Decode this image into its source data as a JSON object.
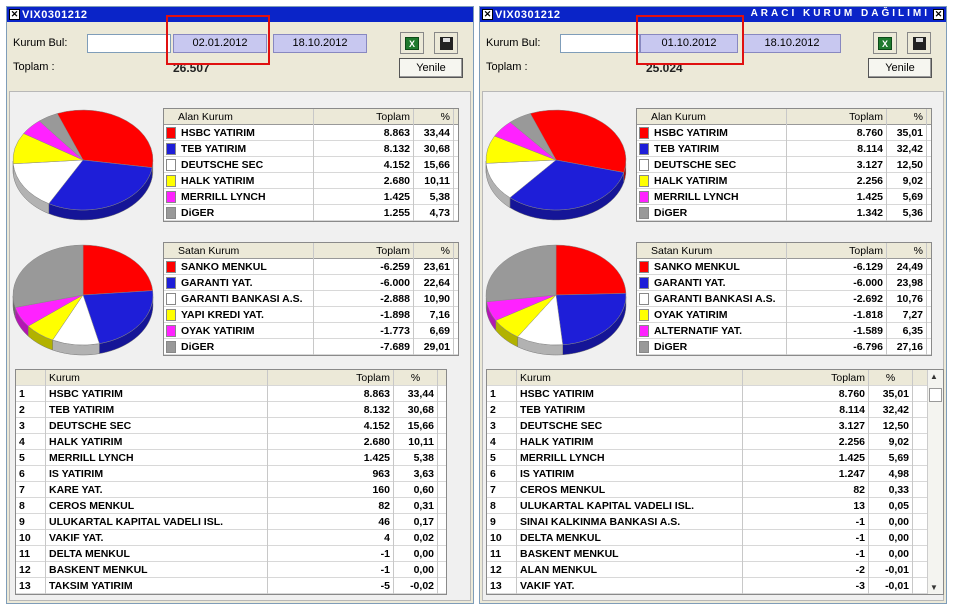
{
  "colors": {
    "red": "#ff0000",
    "blue": "#1e1ed8",
    "white": "#ffffff",
    "yellow": "#ffff00",
    "magenta": "#ff22ff",
    "gray": "#999999"
  },
  "panels": [
    {
      "title": "VIX0301212",
      "subtitle": "",
      "kurum_label": "Kurum Bul:",
      "date_from": "02.01.2012",
      "date_to": "18.10.2012",
      "toplam_label": "Toplam :",
      "toplam_value": "26.507",
      "yenile_label": "Yenile",
      "alan": {
        "headers": [
          "Alan Kurum",
          "Toplam",
          "%"
        ],
        "rows": [
          {
            "name": "HSBC YATIRIM",
            "toplam": "8.863",
            "pct": "33,44",
            "color": "#ff0000"
          },
          {
            "name": "TEB YATIRIM",
            "toplam": "8.132",
            "pct": "30,68",
            "color": "#1e1ed8"
          },
          {
            "name": "DEUTSCHE SEC",
            "toplam": "4.152",
            "pct": "15,66",
            "color": "#ffffff"
          },
          {
            "name": "HALK YATIRIM",
            "toplam": "2.680",
            "pct": "10,11",
            "color": "#ffff00"
          },
          {
            "name": "MERRILL LYNCH",
            "toplam": "1.425",
            "pct": "5,38",
            "color": "#ff22ff"
          },
          {
            "name": "DiGER",
            "toplam": "1.255",
            "pct": "4,73",
            "color": "#999999"
          }
        ],
        "pie_values": [
          33.44,
          30.68,
          15.66,
          10.11,
          5.38,
          4.73
        ]
      },
      "satan": {
        "headers": [
          "Satan Kurum",
          "Toplam",
          "%"
        ],
        "rows": [
          {
            "name": "SANKO MENKUL",
            "toplam": "-6.259",
            "pct": "23,61",
            "color": "#ff0000"
          },
          {
            "name": "GARANTI YAT.",
            "toplam": "-6.000",
            "pct": "22,64",
            "color": "#1e1ed8"
          },
          {
            "name": "GARANTI BANKASI A.S.",
            "toplam": "-2.888",
            "pct": "10,90",
            "color": "#ffffff"
          },
          {
            "name": "YAPI KREDI YAT.",
            "toplam": "-1.898",
            "pct": "7,16",
            "color": "#ffff00"
          },
          {
            "name": "OYAK YATIRIM",
            "toplam": "-1.773",
            "pct": "6,69",
            "color": "#ff22ff"
          },
          {
            "name": "DiGER",
            "toplam": "-7.689",
            "pct": "29,01",
            "color": "#999999"
          }
        ],
        "pie_values": [
          23.61,
          22.64,
          10.9,
          7.16,
          6.69,
          29.01
        ]
      },
      "list": {
        "headers": [
          "",
          "Kurum",
          "Toplam",
          "%"
        ],
        "rows": [
          [
            "1",
            "HSBC YATIRIM",
            "8.863",
            "33,44"
          ],
          [
            "2",
            "TEB YATIRIM",
            "8.132",
            "30,68"
          ],
          [
            "3",
            "DEUTSCHE SEC",
            "4.152",
            "15,66"
          ],
          [
            "4",
            "HALK YATIRIM",
            "2.680",
            "10,11"
          ],
          [
            "5",
            "MERRILL LYNCH",
            "1.425",
            "5,38"
          ],
          [
            "6",
            "IS YATIRIM",
            "963",
            "3,63"
          ],
          [
            "7",
            "KARE YAT.",
            "160",
            "0,60"
          ],
          [
            "8",
            "CEROS MENKUL",
            "82",
            "0,31"
          ],
          [
            "9",
            "ULUKARTAL KAPITAL VADELI ISL.",
            "46",
            "0,17"
          ],
          [
            "10",
            "VAKIF YAT.",
            "4",
            "0,02"
          ],
          [
            "11",
            "DELTA MENKUL",
            "-1",
            "0,00"
          ],
          [
            "12",
            "BASKENT MENKUL",
            "-1",
            "0,00"
          ],
          [
            "13",
            "TAKSIM YATIRIM",
            "-5",
            "-0,02"
          ]
        ]
      }
    },
    {
      "title": "VIX0301212",
      "subtitle": "ARACI KURUM DAĞILIMI",
      "kurum_label": "Kurum Bul:",
      "date_from": "01.10.2012",
      "date_to": "18.10.2012",
      "toplam_label": "Toplam :",
      "toplam_value": "25.024",
      "yenile_label": "Yenile",
      "alan": {
        "headers": [
          "Alan Kurum",
          "Toplam",
          "%"
        ],
        "rows": [
          {
            "name": "HSBC YATIRIM",
            "toplam": "8.760",
            "pct": "35,01",
            "color": "#ff0000"
          },
          {
            "name": "TEB YATIRIM",
            "toplam": "8.114",
            "pct": "32,42",
            "color": "#1e1ed8"
          },
          {
            "name": "DEUTSCHE SEC",
            "toplam": "3.127",
            "pct": "12,50",
            "color": "#ffffff"
          },
          {
            "name": "HALK YATIRIM",
            "toplam": "2.256",
            "pct": "9,02",
            "color": "#ffff00"
          },
          {
            "name": "MERRILL LYNCH",
            "toplam": "1.425",
            "pct": "5,69",
            "color": "#ff22ff"
          },
          {
            "name": "DiGER",
            "toplam": "1.342",
            "pct": "5,36",
            "color": "#999999"
          }
        ],
        "pie_values": [
          35.01,
          32.42,
          12.5,
          9.02,
          5.69,
          5.36
        ]
      },
      "satan": {
        "headers": [
          "Satan Kurum",
          "Toplam",
          "%"
        ],
        "rows": [
          {
            "name": "SANKO MENKUL",
            "toplam": "-6.129",
            "pct": "24,49",
            "color": "#ff0000"
          },
          {
            "name": "GARANTI YAT.",
            "toplam": "-6.000",
            "pct": "23,98",
            "color": "#1e1ed8"
          },
          {
            "name": "GARANTI BANKASI A.S.",
            "toplam": "-2.692",
            "pct": "10,76",
            "color": "#ffffff"
          },
          {
            "name": "OYAK YATIRIM",
            "toplam": "-1.818",
            "pct": "7,27",
            "color": "#ffff00"
          },
          {
            "name": "ALTERNATIF YAT.",
            "toplam": "-1.589",
            "pct": "6,35",
            "color": "#ff22ff"
          },
          {
            "name": "DiGER",
            "toplam": "-6.796",
            "pct": "27,16",
            "color": "#999999"
          }
        ],
        "pie_values": [
          24.49,
          23.98,
          10.76,
          7.27,
          6.35,
          27.16
        ]
      },
      "list": {
        "headers": [
          "",
          "Kurum",
          "Toplam",
          "%"
        ],
        "rows": [
          [
            "1",
            "HSBC YATIRIM",
            "8.760",
            "35,01"
          ],
          [
            "2",
            "TEB YATIRIM",
            "8.114",
            "32,42"
          ],
          [
            "3",
            "DEUTSCHE SEC",
            "3.127",
            "12,50"
          ],
          [
            "4",
            "HALK YATIRIM",
            "2.256",
            "9,02"
          ],
          [
            "5",
            "MERRILL LYNCH",
            "1.425",
            "5,69"
          ],
          [
            "6",
            "IS YATIRIM",
            "1.247",
            "4,98"
          ],
          [
            "7",
            "CEROS MENKUL",
            "82",
            "0,33"
          ],
          [
            "8",
            "ULUKARTAL KAPITAL VADELI ISL.",
            "13",
            "0,05"
          ],
          [
            "9",
            "SINAI KALKINMA BANKASI A.S.",
            "-1",
            "0,00"
          ],
          [
            "10",
            "DELTA MENKUL",
            "-1",
            "0,00"
          ],
          [
            "11",
            "BASKENT MENKUL",
            "-1",
            "0,00"
          ],
          [
            "12",
            "ALAN MENKUL",
            "-2",
            "-0,01"
          ],
          [
            "13",
            "VAKIF YAT.",
            "-3",
            "-0,01"
          ]
        ]
      }
    }
  ],
  "chart_data": [
    {
      "type": "pie",
      "categories": [
        "HSBC YATIRIM",
        "TEB YATIRIM",
        "DEUTSCHE SEC",
        "HALK YATIRIM",
        "MERRILL LYNCH",
        "DiGER"
      ],
      "values": [
        33.44,
        30.68,
        15.66,
        10.11,
        5.38,
        4.73
      ]
    },
    {
      "type": "pie",
      "categories": [
        "SANKO MENKUL",
        "GARANTI YAT.",
        "GARANTI BANKASI A.S.",
        "YAPI KREDI YAT.",
        "OYAK YATIRIM",
        "DiGER"
      ],
      "values": [
        23.61,
        22.64,
        10.9,
        7.16,
        6.69,
        29.01
      ]
    },
    {
      "type": "pie",
      "categories": [
        "HSBC YATIRIM",
        "TEB YATIRIM",
        "DEUTSCHE SEC",
        "HALK YATIRIM",
        "MERRILL LYNCH",
        "DiGER"
      ],
      "values": [
        35.01,
        32.42,
        12.5,
        9.02,
        5.69,
        5.36
      ]
    },
    {
      "type": "pie",
      "categories": [
        "SANKO MENKUL",
        "GARANTI YAT.",
        "GARANTI BANKASI A.S.",
        "OYAK YATIRIM",
        "ALTERNATIF YAT.",
        "DiGER"
      ],
      "values": [
        24.49,
        23.98,
        10.76,
        7.27,
        6.35,
        27.16
      ]
    }
  ]
}
